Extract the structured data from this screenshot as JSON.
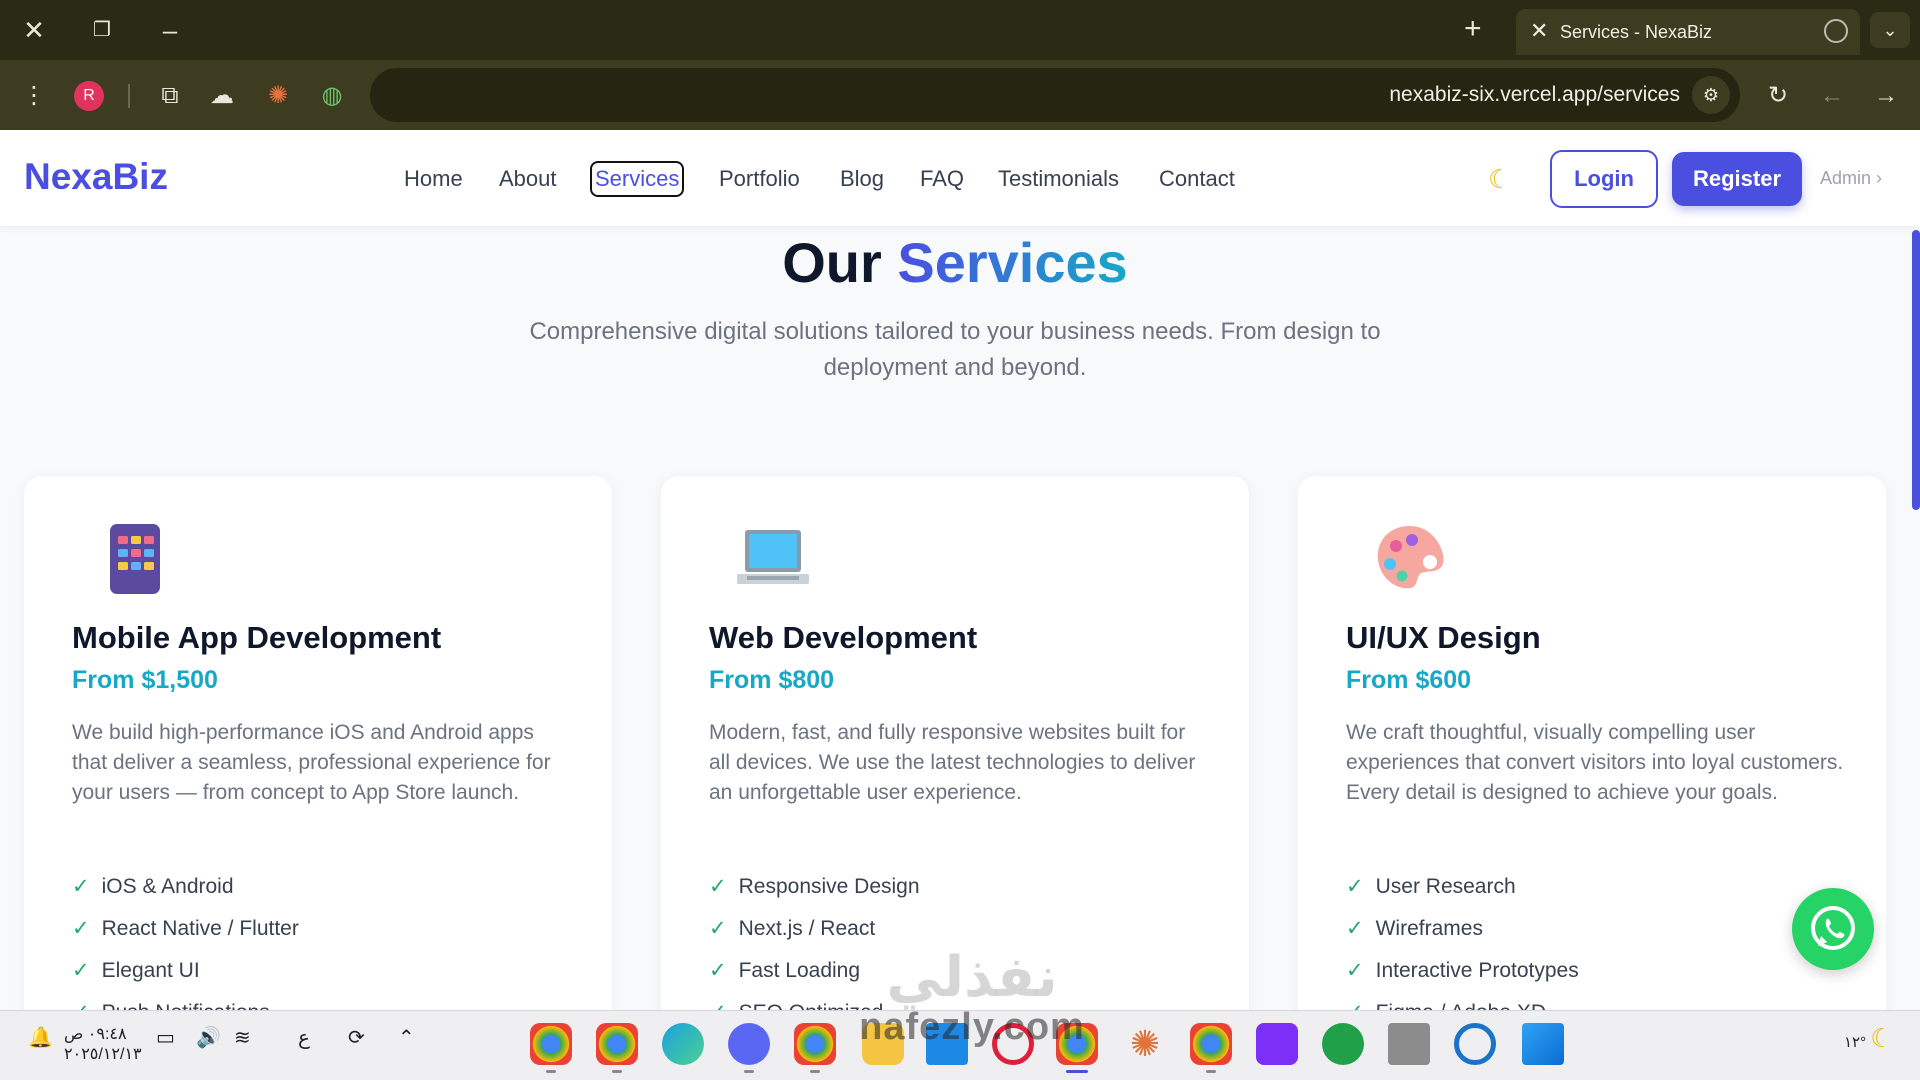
{
  "browser": {
    "tab_title": "Services - NexaBiz",
    "url": "nexabiz-six.vercel.app/services",
    "profile_initial": "R"
  },
  "nav": {
    "logo": "NexaBiz",
    "links": [
      "Home",
      "About",
      "Services",
      "Portfolio",
      "Blog",
      "FAQ",
      "Testimonials",
      "Contact"
    ],
    "active": "Services",
    "login": "Login",
    "register": "Register",
    "admin": "Admin ›"
  },
  "hero": {
    "title_part1": "Our ",
    "title_part2": "Services",
    "subtitle": "Comprehensive digital solutions tailored to your business needs. From design to deployment and beyond."
  },
  "services": [
    {
      "icon": "tablet-app-icon",
      "title": "Mobile App Development",
      "price": "From $1,500",
      "description": "We build high-performance iOS and Android apps that deliver a seamless, professional experience for your users — from concept to App Store launch.",
      "features": [
        "iOS & Android",
        "React Native / Flutter",
        "Elegant UI",
        "Push Notifications"
      ]
    },
    {
      "icon": "laptop-icon",
      "title": "Web Development",
      "price": "From $800",
      "description": "Modern, fast, and fully responsive websites built for all devices. We use the latest technologies to deliver an unforgettable user experience.",
      "features": [
        "Responsive Design",
        "Next.js / React",
        "Fast Loading",
        "SEO Optimized"
      ]
    },
    {
      "icon": "palette-icon",
      "title": "UI/UX Design",
      "price": "From $600",
      "description": "We craft thoughtful, visually compelling user experiences that convert visitors into loyal customers. Every detail is designed to achieve your goals.",
      "features": [
        "User Research",
        "Wireframes",
        "Interactive Prototypes",
        "Figma / Adobe XD"
      ]
    }
  ],
  "watermark": {
    "arabic": "نفذلي",
    "latin": "nafezly.com"
  },
  "taskbar": {
    "time": "٠٩:٤٨ ص",
    "date": "٢٠٢٥/١٢/١٣",
    "lang": "ع",
    "temp": "١٢°"
  },
  "colors": {
    "brand": "#4a4fe0",
    "price": "#18a8c6",
    "check": "#22a86b",
    "whatsapp": "#25d366"
  }
}
